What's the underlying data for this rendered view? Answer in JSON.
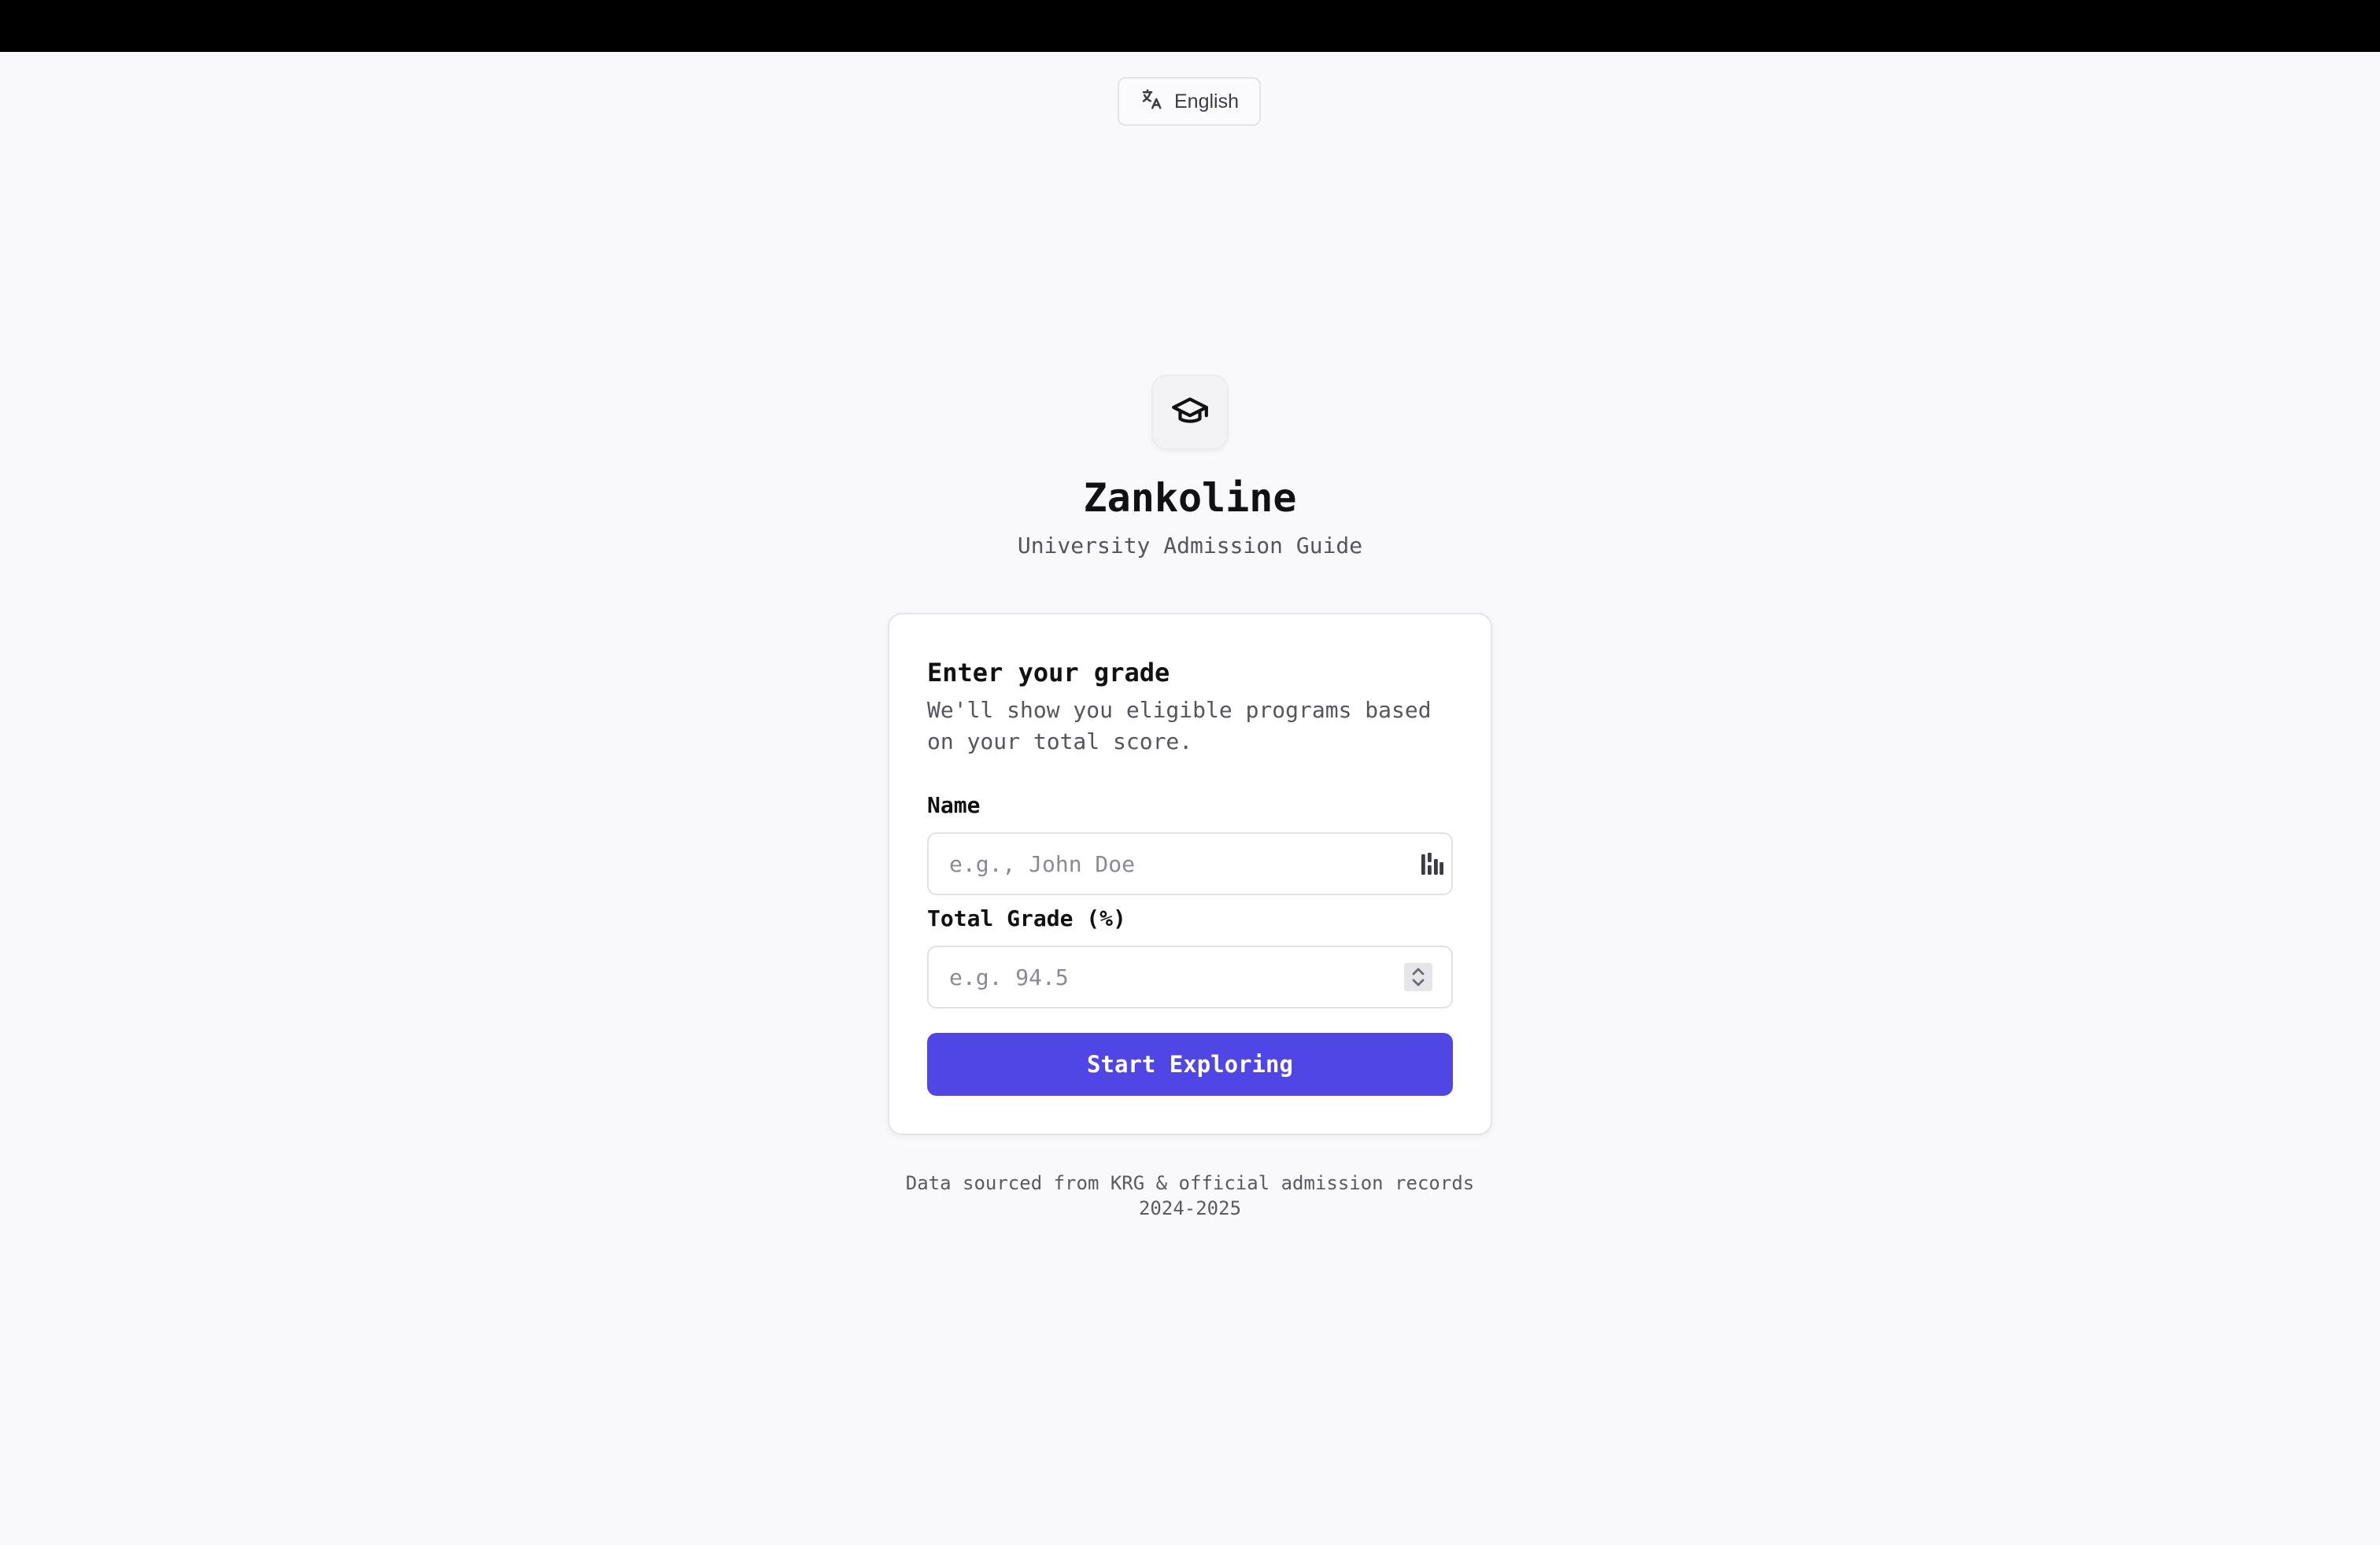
{
  "language_switcher": {
    "label": "English",
    "icon": "translate-icon"
  },
  "brand": {
    "icon": "graduation-cap-icon",
    "title": "Zankoline",
    "subtitle": "University Admission Guide"
  },
  "form": {
    "title": "Enter your grade",
    "description": "We'll show you eligible programs based on your total score.",
    "name_field": {
      "label": "Name",
      "value": "",
      "placeholder": "e.g., John Doe",
      "icon": "autofill-icon"
    },
    "grade_field": {
      "label": "Total Grade (%)",
      "value": "",
      "placeholder": "e.g. 94.5",
      "icon": "number-stepper-icon"
    },
    "submit_label": "Start Exploring"
  },
  "footer": {
    "line1": "Data sourced from KRG & official admission records",
    "line2": "2024-2025"
  },
  "colors": {
    "accent": "#4f46e5",
    "background": "#f9f9fb",
    "topbar": "#000000"
  }
}
